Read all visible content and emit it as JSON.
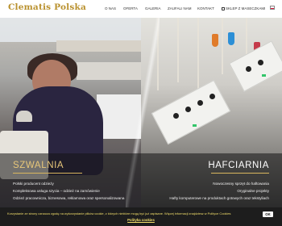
{
  "header": {
    "logo": "Clematis Polska",
    "nav": [
      {
        "label": "O NAS"
      },
      {
        "label": "OFERTA"
      },
      {
        "label": "GALERIA"
      },
      {
        "label": "ZAUFALI NAM"
      },
      {
        "label": "KONTAKT"
      },
      {
        "label": "SKLEP Z MASECZKAMI"
      }
    ],
    "icons": {
      "cart": "cart-icon",
      "language": "polish-flag-icon"
    }
  },
  "panels": {
    "left": {
      "title": "SZWALNIA",
      "lines": [
        "Polski producent odzieży",
        "Kompleksowa usługa szycia – odzież na zamówienie",
        "Odzież pracownicza, biznesowa, reklamowa oraz spersonalizowana"
      ]
    },
    "right": {
      "title": "HAFCIARNIA",
      "lines": [
        "Nowoczesny sprzęt do haftowania",
        "Oryginalne projekty",
        "Hafty komputerowe na produktach gotowych oraz tekstyliach"
      ]
    }
  },
  "cookie": {
    "text": "Korzystanie ze strony oznacza zgodę na wykorzystanie plików cookie, z których niektóre mogą być już zapisane. Więcej informacji znajdziesz w Polityce Cookies",
    "link": "Polityka cookies",
    "ok": "OK"
  },
  "colors": {
    "logo": "#b9912e",
    "accent": "#d9b65e",
    "cookie_text": "#f3df6b",
    "cookie_bg": "#1d1d1d"
  }
}
